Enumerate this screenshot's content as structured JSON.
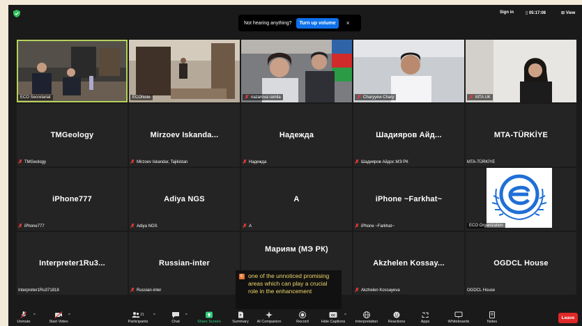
{
  "colors": {
    "background": "#1a1a1a",
    "tile": "#242424",
    "accent": "#0e71eb",
    "active_speaker": "#b5d25c",
    "leave": "#e02828",
    "caption_text": "#f0d86a",
    "share_screen": "#2fcf7b"
  },
  "topbar": {
    "notification_text": "Not hearing anything?",
    "notification_button": "Turn up volume",
    "close": "×",
    "sign_in": "Sign in",
    "timer": "05:17:08",
    "view": "View"
  },
  "tiles": [
    {
      "name": "",
      "label": "ECO Secretariat",
      "muted": false
    },
    {
      "name": "",
      "label": "ECONote",
      "muted": false
    },
    {
      "name": "",
      "label": "nazarova ramila",
      "muted": true
    },
    {
      "name": "",
      "label": "Charyyew Chary",
      "muted": true
    },
    {
      "name": "",
      "label": "MTA UK",
      "muted": true
    },
    {
      "name": "TMGeology",
      "label": "TMGeology",
      "muted": true
    },
    {
      "name": "Mirzoev Iskanda...",
      "label": "Mirzoev Iskandar, Tajikistan",
      "muted": true
    },
    {
      "name": "Надежда",
      "label": "Надежда",
      "muted": true
    },
    {
      "name": "Шадияров Айд...",
      "label": "Шадияров Айдос МЭ РК",
      "muted": true
    },
    {
      "name": "MTA-TÜRKİYE",
      "label": "MTA-TÜRKİYE",
      "muted": false
    },
    {
      "name": "iPhone777",
      "label": "iPhone777",
      "muted": true
    },
    {
      "name": "Adiya NGS",
      "label": "Adiya NGS",
      "muted": true
    },
    {
      "name": "A",
      "label": "A",
      "muted": true
    },
    {
      "name": "iPhone ~Farkhat~",
      "label": "iPhone ~Farkhat~",
      "muted": true
    },
    {
      "name": "",
      "label": "ECO Organization",
      "muted": false
    },
    {
      "name": "Interpreter1Ru3...",
      "label": "Interpreter1Ru371818",
      "muted": false
    },
    {
      "name": "Russian-inter",
      "label": "Russian-inter",
      "muted": true
    },
    {
      "name": "Мариям (МЭ РК)",
      "label": "",
      "muted": false
    },
    {
      "name": "Akzhelen Kossay...",
      "label": "Akzhelen Kossayeva",
      "muted": true
    },
    {
      "name": "OGDCL House",
      "label": "OGDCL House",
      "muted": false
    }
  ],
  "caption": {
    "badge": "E",
    "text": "one of the unnoticed promising areas which can play a crucial role in the enhancement"
  },
  "toolbar": {
    "unmute": "Unmute",
    "start_video": "Start Video",
    "participants": "Participants",
    "participants_count": "21",
    "chat": "Chat",
    "share_screen": "Share Screen",
    "summary": "Summary",
    "ai_companion": "AI Companion",
    "record": "Record",
    "hide_captions": "Hide Captions",
    "interpretation": "Interpretation",
    "reactions": "Reactions",
    "apps": "Apps",
    "whiteboards": "Whiteboards",
    "notes": "Notes",
    "leave": "Leave"
  }
}
